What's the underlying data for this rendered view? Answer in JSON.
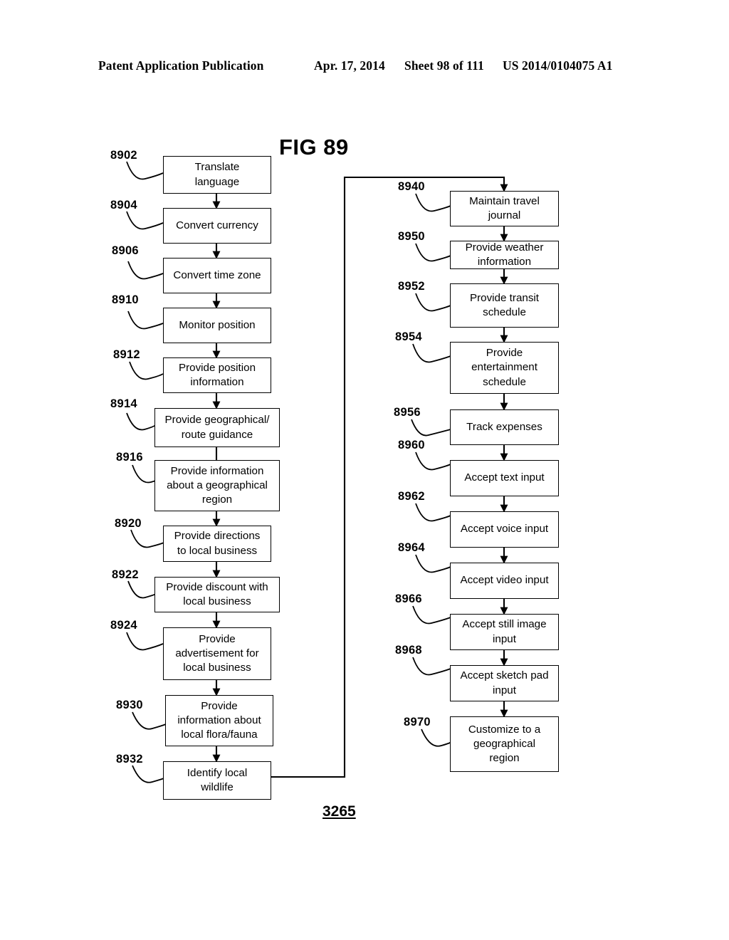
{
  "header": {
    "publication": "Patent Application Publication",
    "date": "Apr. 17, 2014",
    "sheet": "Sheet 98 of 111",
    "patent_number": "US 2014/0104075 A1"
  },
  "figure": {
    "title": "FIG 89",
    "number": "3265"
  },
  "colors": {
    "ink": "#000000",
    "page": "#ffffff"
  },
  "flowchart": {
    "left_column": [
      {
        "ref": "8902",
        "label": "Translate language",
        "lines": [
          "Translate",
          "language"
        ]
      },
      {
        "ref": "8904",
        "label": "Convert currency",
        "lines": [
          "Convert currency"
        ]
      },
      {
        "ref": "8906",
        "label": "Convert time zone",
        "lines": [
          "Convert time zone"
        ]
      },
      {
        "ref": "8910",
        "label": "Monitor position",
        "lines": [
          "Monitor position"
        ]
      },
      {
        "ref": "8912",
        "label": "Provide position information",
        "lines": [
          "Provide position",
          "information"
        ]
      },
      {
        "ref": "8914",
        "label": "Provide geographical/ route guidance",
        "lines": [
          "Provide geographical/",
          "route guidance"
        ]
      },
      {
        "ref": "8916",
        "label": "Provide information about a geographical region",
        "lines": [
          "Provide information",
          "about a geographical",
          "region"
        ]
      },
      {
        "ref": "8920",
        "label": "Provide directions to local business",
        "lines": [
          "Provide directions",
          "to local business"
        ]
      },
      {
        "ref": "8922",
        "label": "Provide discount with local business",
        "lines": [
          "Provide discount with",
          "local business"
        ]
      },
      {
        "ref": "8924",
        "label": "Provide advertisement for local business",
        "lines": [
          "Provide",
          "advertisement for",
          "local business"
        ]
      },
      {
        "ref": "8930",
        "label": "Provide information about local flora/fauna",
        "lines": [
          "Provide",
          "information about",
          "local flora/fauna"
        ]
      },
      {
        "ref": "8932",
        "label": "Identify local wildlife",
        "lines": [
          "Identify local",
          "wildlife"
        ]
      }
    ],
    "right_column": [
      {
        "ref": "8940",
        "label": "Maintain travel journal",
        "lines": [
          "Maintain travel",
          "journal"
        ]
      },
      {
        "ref": "8950",
        "label": "Provide weather information",
        "lines": [
          "Provide weather",
          "information"
        ]
      },
      {
        "ref": "8952",
        "label": "Provide transit schedule",
        "lines": [
          "Provide transit",
          "schedule"
        ]
      },
      {
        "ref": "8954",
        "label": "Provide entertainment schedule",
        "lines": [
          "Provide",
          "entertainment",
          "schedule"
        ]
      },
      {
        "ref": "8956",
        "label": "Track expenses",
        "lines": [
          "Track expenses"
        ]
      },
      {
        "ref": "8960",
        "label": "Accept text input",
        "lines": [
          "Accept text input"
        ]
      },
      {
        "ref": "8962",
        "label": "Accept voice input",
        "lines": [
          "Accept voice input"
        ]
      },
      {
        "ref": "8964",
        "label": "Accept video input",
        "lines": [
          "Accept video input"
        ]
      },
      {
        "ref": "8966",
        "label": "Accept still image input",
        "lines": [
          "Accept still image",
          "input"
        ]
      },
      {
        "ref": "8968",
        "label": "Accept sketch pad input",
        "lines": [
          "Accept sketch pad",
          "input"
        ]
      },
      {
        "ref": "8970",
        "label": "Customize to a geographical region",
        "lines": [
          "Customize to a",
          "geographical",
          "region"
        ]
      }
    ]
  }
}
